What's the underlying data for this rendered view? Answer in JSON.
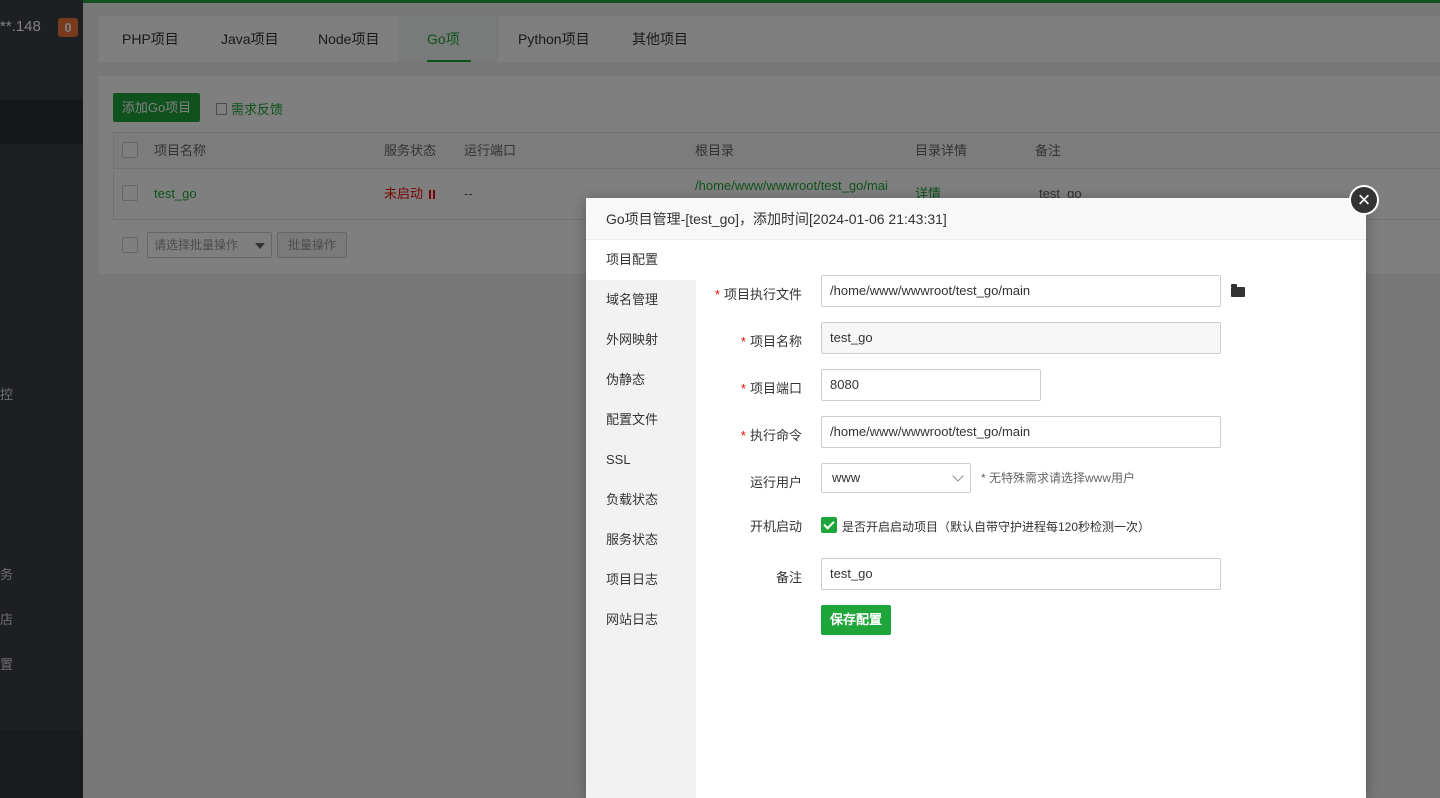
{
  "sidebar": {
    "ip_suffix": "**.148",
    "badge": "0",
    "fragments": [
      "控",
      "务",
      "店",
      "置"
    ]
  },
  "tabs": [
    "PHP项目",
    "Java项目",
    "Node项目",
    "Go项目",
    "Python项目",
    "其他项目"
  ],
  "toolbar": {
    "add_label": "添加Go项目",
    "feedback_label": "需求反馈"
  },
  "table": {
    "headers": [
      "项目名称",
      "服务状态",
      "运行端口",
      "根目录",
      "目录详情",
      "备注"
    ],
    "row": {
      "name": "test_go",
      "status": "未启动",
      "port": "--",
      "root": "/home/www/wwwroot/test_go/mai",
      "detail": "详情",
      "remark": "test_go"
    },
    "batch_placeholder": "请选择批量操作",
    "batch_button": "批量操作"
  },
  "modal": {
    "title": "Go项目管理-[test_go]，添加时间[2024-01-06 21:43:31]",
    "nav": [
      "项目配置",
      "域名管理",
      "外网映射",
      "伪静态",
      "配置文件",
      "SSL",
      "负载状态",
      "服务状态",
      "项目日志",
      "网站日志"
    ],
    "form": {
      "exec_label": "项目执行文件",
      "exec_value": "/home/www/wwwroot/test_go/main",
      "name_label": "项目名称",
      "name_value": "test_go",
      "port_label": "项目端口",
      "port_value": "8080",
      "cmd_label": "执行命令",
      "cmd_value": "/home/www/wwwroot/test_go/main",
      "user_label": "运行用户",
      "user_value": "www",
      "user_hint": "* 无特殊需求请选择www用户",
      "boot_label": "开机启动",
      "boot_text": "是否开启启动项目（默认自带守护进程每120秒检测一次）",
      "remark_label": "备注",
      "remark_value": "test_go",
      "save_label": "保存配置"
    }
  },
  "colors": {
    "accent": "#20a53a",
    "danger": "#ef0808",
    "badge": "#f0743b"
  }
}
